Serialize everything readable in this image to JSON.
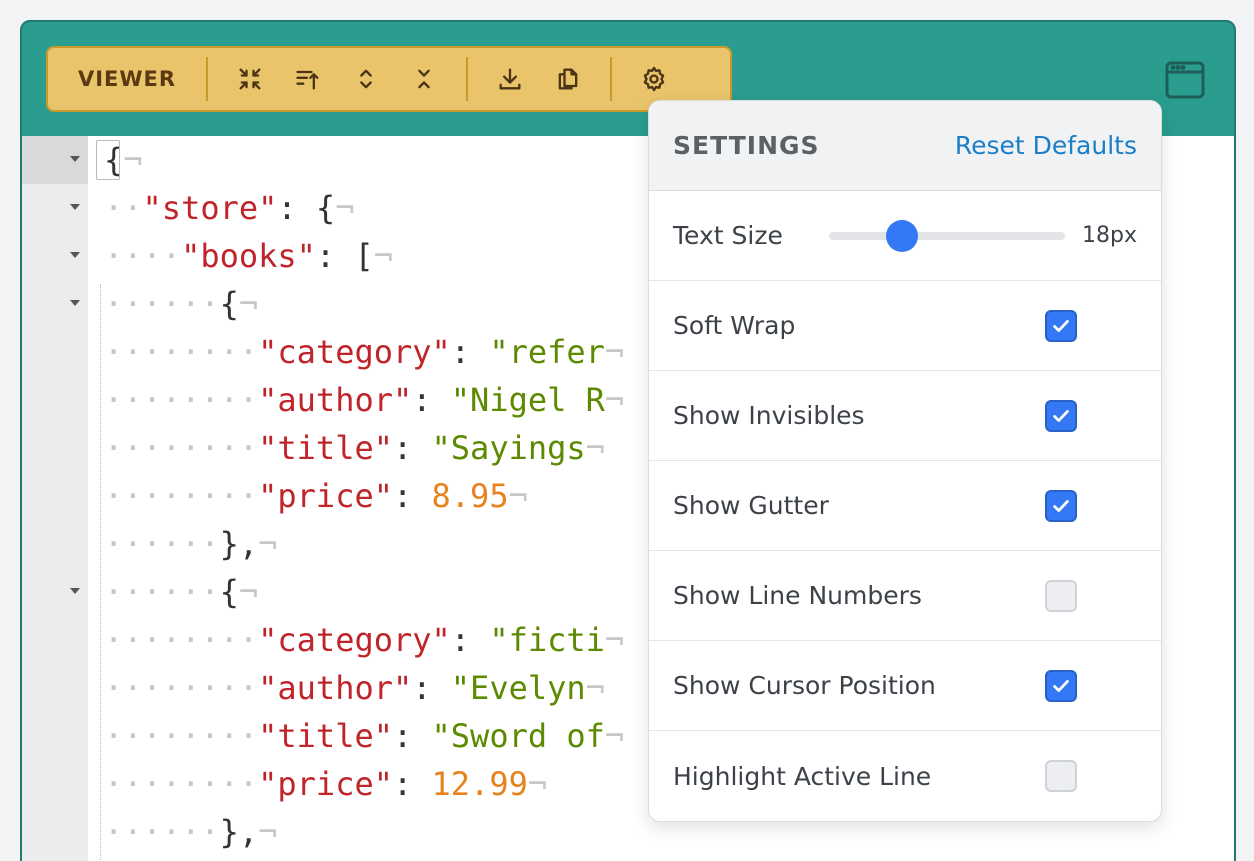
{
  "toolbar": {
    "label": "VIEWER",
    "buttons": [
      "collapse-icon",
      "sort-icon",
      "expand-all-icon",
      "collapse-all-icon",
      "download-icon",
      "copy-icon",
      "gear-icon"
    ]
  },
  "editor": {
    "lines": [
      {
        "indent": 0,
        "parts": [
          [
            "pun",
            "{"
          ]
        ]
      },
      {
        "indent": 1,
        "parts": [
          [
            "key",
            "\"store\""
          ],
          [
            "pun",
            ": {"
          ]
        ]
      },
      {
        "indent": 2,
        "parts": [
          [
            "key",
            "\"books\""
          ],
          [
            "pun",
            ": ["
          ]
        ]
      },
      {
        "indent": 3,
        "parts": [
          [
            "pun",
            "{"
          ]
        ]
      },
      {
        "indent": 4,
        "parts": [
          [
            "key",
            "\"category\""
          ],
          [
            "pun",
            ": "
          ],
          [
            "str",
            "\"refer"
          ]
        ]
      },
      {
        "indent": 4,
        "parts": [
          [
            "key",
            "\"author\""
          ],
          [
            "pun",
            ": "
          ],
          [
            "str",
            "\"Nigel R"
          ]
        ]
      },
      {
        "indent": 4,
        "parts": [
          [
            "key",
            "\"title\""
          ],
          [
            "pun",
            ": "
          ],
          [
            "str",
            "\"Sayings"
          ]
        ]
      },
      {
        "indent": 4,
        "parts": [
          [
            "key",
            "\"price\""
          ],
          [
            "pun",
            ": "
          ],
          [
            "num",
            "8.95"
          ]
        ]
      },
      {
        "indent": 3,
        "parts": [
          [
            "pun",
            "},"
          ]
        ]
      },
      {
        "indent": 3,
        "parts": [
          [
            "pun",
            "{"
          ]
        ]
      },
      {
        "indent": 4,
        "parts": [
          [
            "key",
            "\"category\""
          ],
          [
            "pun",
            ": "
          ],
          [
            "str",
            "\"ficti"
          ]
        ]
      },
      {
        "indent": 4,
        "parts": [
          [
            "key",
            "\"author\""
          ],
          [
            "pun",
            ": "
          ],
          [
            "str",
            "\"Evelyn"
          ]
        ]
      },
      {
        "indent": 4,
        "parts": [
          [
            "key",
            "\"title\""
          ],
          [
            "pun",
            ": "
          ],
          [
            "str",
            "\"Sword of"
          ]
        ]
      },
      {
        "indent": 4,
        "parts": [
          [
            "key",
            "\"price\""
          ],
          [
            "pun",
            ": "
          ],
          [
            "num",
            "12.99"
          ]
        ]
      },
      {
        "indent": 3,
        "parts": [
          [
            "pun",
            "},"
          ]
        ]
      }
    ],
    "fold_lines": [
      0,
      1,
      2,
      3,
      9
    ]
  },
  "settings": {
    "title": "SETTINGS",
    "reset_label": "Reset Defaults",
    "text_size": {
      "label": "Text Size",
      "value": "18px",
      "fraction": 0.28
    },
    "options": [
      {
        "label": "Soft Wrap",
        "checked": true
      },
      {
        "label": "Show Invisibles",
        "checked": true
      },
      {
        "label": "Show Gutter",
        "checked": true
      },
      {
        "label": "Show Line Numbers",
        "checked": false
      },
      {
        "label": "Show Cursor Position",
        "checked": true
      },
      {
        "label": "Highlight Active Line",
        "checked": false
      }
    ]
  }
}
